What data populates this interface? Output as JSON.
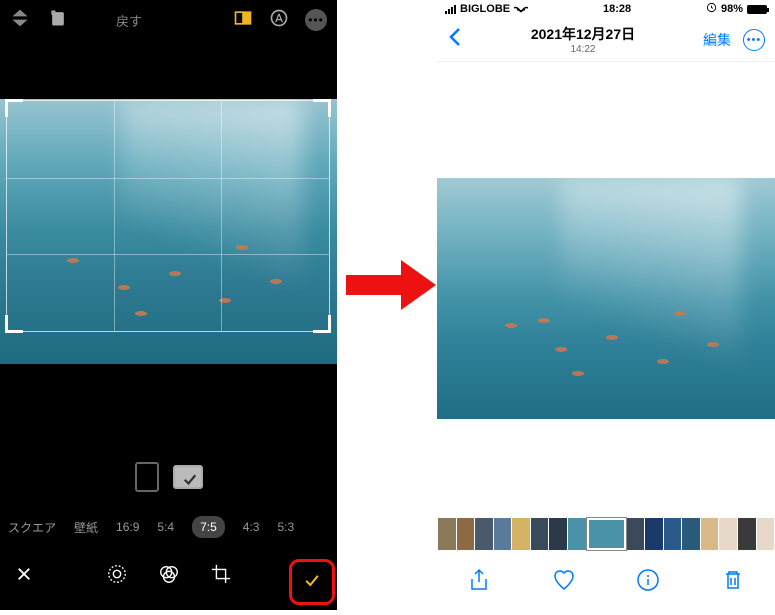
{
  "left": {
    "topbar": {
      "flip_icon": "flip-vertical-icon",
      "rotate_icon": "rotate-icon",
      "undo_label": "戻す",
      "aspect_icon": "aspect-ratio-icon",
      "markup_icon": "markup-icon",
      "more_icon": "more-icon"
    },
    "orientation": {
      "portrait": "portrait",
      "landscape_checked": "landscape"
    },
    "ratios": [
      {
        "label": "スクエア",
        "active": false
      },
      {
        "label": "壁紙",
        "active": false
      },
      {
        "label": "16:9",
        "active": false
      },
      {
        "label": "5:4",
        "active": false
      },
      {
        "label": "7:5",
        "active": true
      },
      {
        "label": "4:3",
        "active": false
      },
      {
        "label": "5:3",
        "active": false
      }
    ],
    "bottom": {
      "cancel": "cancel-icon",
      "adjust": "adjust-icon",
      "filters": "filters-icon",
      "crop": "crop-icon",
      "confirm": "confirm-icon"
    }
  },
  "right": {
    "status": {
      "carrier": "BIGLOBE",
      "time": "18:28",
      "battery_pct": "98%"
    },
    "nav": {
      "date": "2021年12月27日",
      "time": "14:22",
      "edit": "編集"
    },
    "actions": {
      "share": "share-icon",
      "favorite": "heart-icon",
      "info": "info-icon",
      "delete": "trash-icon"
    }
  },
  "thumbs_colors": [
    "#8a7a5a",
    "#8b6a44",
    "#4a5a6a",
    "#5a7a9a",
    "#d4b464",
    "#3a4a5a",
    "#2a3a4a",
    "#4a92a8",
    "#4a92a8",
    "#3a4a5a",
    "#1a3a6a",
    "#2a5a8a",
    "#2a5a7a",
    "#d8b888",
    "#e8d8c8",
    "#3a3a3a",
    "#e8d8c8"
  ],
  "thumb_current_index": 8
}
